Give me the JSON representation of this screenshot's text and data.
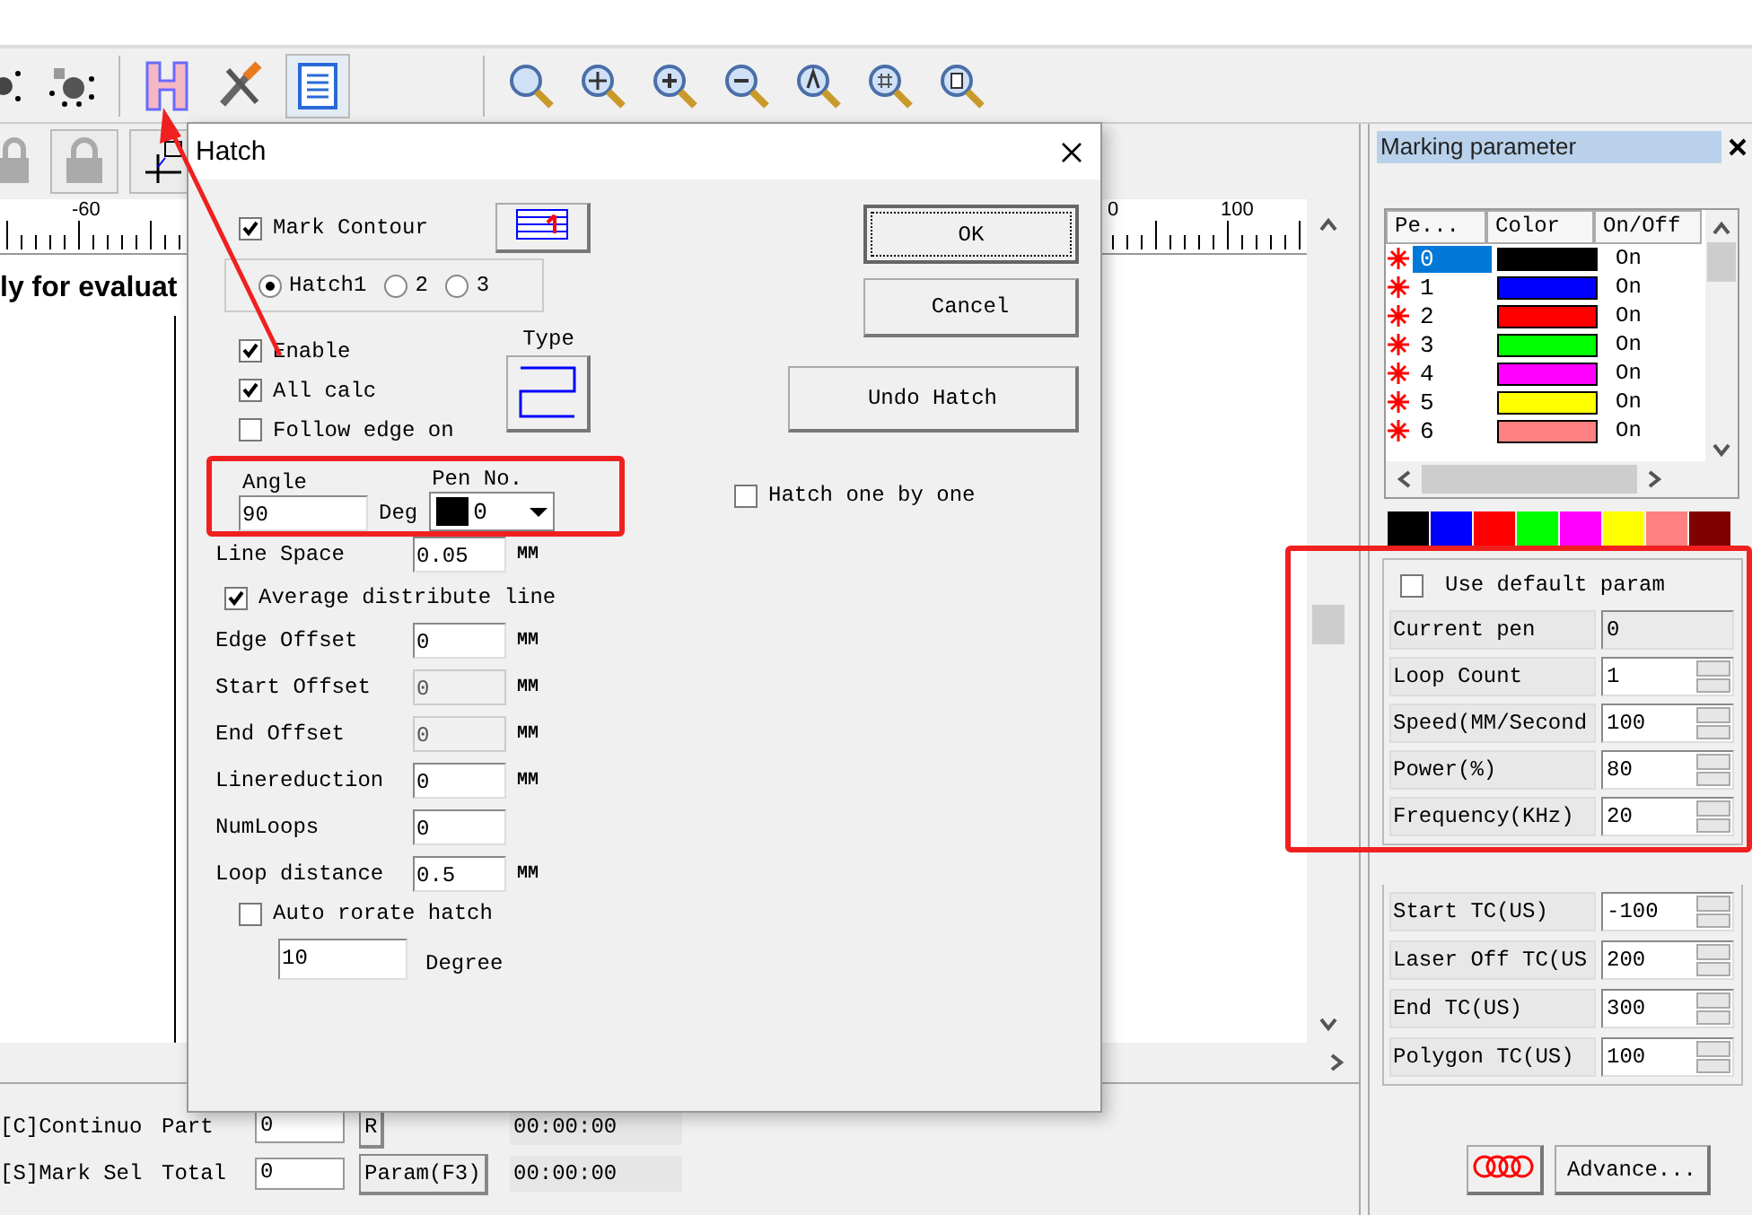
{
  "dialog": {
    "title": "Hatch",
    "mark_contour": {
      "label": "Mark Contour",
      "checked": true
    },
    "hatch_tabs": [
      {
        "label": "Hatch1",
        "selected": true
      },
      {
        "label": "2",
        "selected": false
      },
      {
        "label": "3",
        "selected": false
      }
    ],
    "options": [
      {
        "label": "Enable",
        "checked": true
      },
      {
        "label": "All calc",
        "checked": true
      },
      {
        "label": "Follow edge on",
        "checked": false
      }
    ],
    "type_label": "Type",
    "angle": {
      "label": "Angle",
      "value": "90",
      "unit": "Deg"
    },
    "pen_no": {
      "label": "Pen No.",
      "value": "0",
      "color": "#000000"
    },
    "fields": [
      {
        "kind": "field",
        "label": "Line Space",
        "value": "0.05",
        "unit": "MM",
        "disabled": false
      },
      {
        "kind": "checkbox",
        "label": "Average distribute line",
        "checked": true
      },
      {
        "kind": "field",
        "label": "Edge Offset",
        "value": "0",
        "unit": "MM",
        "disabled": false
      },
      {
        "kind": "field",
        "label": "Start Offset",
        "value": "0",
        "unit": "MM",
        "disabled": true
      },
      {
        "kind": "field",
        "label": "End Offset",
        "value": "0",
        "unit": "MM",
        "disabled": true
      },
      {
        "kind": "field",
        "label": "Linereduction",
        "value": "0",
        "unit": "MM",
        "disabled": false
      },
      {
        "kind": "field",
        "label": "NumLoops",
        "value": "0",
        "disabled": false
      },
      {
        "kind": "field",
        "label": "Loop distance",
        "value": "0.5",
        "unit": "MM",
        "disabled": false
      }
    ],
    "auto_rotate": {
      "label": "Auto rorate hatch",
      "checked": false,
      "value": "10",
      "unit": "Degree"
    },
    "buttons": [
      {
        "label": "OK",
        "focused": true
      },
      {
        "label": "Cancel",
        "focused": false
      }
    ],
    "undo_button": "Undo Hatch",
    "hatch_one_by_one": {
      "label": "Hatch one by one",
      "checked": false
    }
  },
  "canvas": {
    "ruler_labels": [
      "-60",
      "0",
      "100"
    ],
    "text": "ly for evaluat"
  },
  "status": {
    "rows": [
      {
        "mode": "[C]Continuo",
        "label": "Part",
        "value": "0",
        "button": "R",
        "time": "00:00:00"
      },
      {
        "mode": "[S]Mark Sel",
        "label": "Total",
        "value": "0",
        "button": "Param(F3)",
        "time": "00:00:00"
      }
    ]
  },
  "panel": {
    "title": "Marking parameter",
    "pen_table": {
      "columns": [
        "Pe...",
        "Color",
        "On/Off"
      ],
      "rows": [
        {
          "pen": "0",
          "color": "#000000",
          "status": "On",
          "selected": true
        },
        {
          "pen": "1",
          "color": "#0000ff",
          "status": "On",
          "selected": false
        },
        {
          "pen": "2",
          "color": "#ff0000",
          "status": "On",
          "selected": false
        },
        {
          "pen": "3",
          "color": "#00ff00",
          "status": "On",
          "selected": false
        },
        {
          "pen": "4",
          "color": "#ff00ff",
          "status": "On",
          "selected": false
        },
        {
          "pen": "5",
          "color": "#ffff00",
          "status": "On",
          "selected": false
        },
        {
          "pen": "6",
          "color": "#ff8080",
          "status": "On",
          "selected": false
        }
      ]
    },
    "palette": [
      {
        "color": "#000000"
      },
      {
        "color": "#0000ff"
      },
      {
        "color": "#ff0000"
      },
      {
        "color": "#00ff00"
      },
      {
        "color": "#ff00ff"
      },
      {
        "color": "#ffff00"
      },
      {
        "color": "#ff8080"
      },
      {
        "color": "#800000"
      }
    ],
    "use_default": {
      "label": "Use default param",
      "checked": false
    },
    "params": [
      {
        "kind": "readonly",
        "label": "Current pen",
        "value": "0"
      },
      {
        "kind": "spin",
        "label": "Loop Count",
        "value": "1"
      },
      {
        "kind": "spin",
        "label": "Speed(MM/Second",
        "value": "100"
      },
      {
        "kind": "spin",
        "label": "Power(%)",
        "value": "80"
      },
      {
        "kind": "spin",
        "label": "Frequency(KHz)",
        "value": "20"
      }
    ],
    "timing": [
      {
        "kind": "spin",
        "label": "Start TC(US)",
        "value": "-100"
      },
      {
        "kind": "spin",
        "label": "Laser Off TC(US",
        "value": "200"
      },
      {
        "kind": "spin",
        "label": "End TC(US)",
        "value": "300"
      },
      {
        "kind": "spin",
        "label": "Polygon TC(US)",
        "value": "100"
      }
    ],
    "advance_button": "Advance..."
  }
}
